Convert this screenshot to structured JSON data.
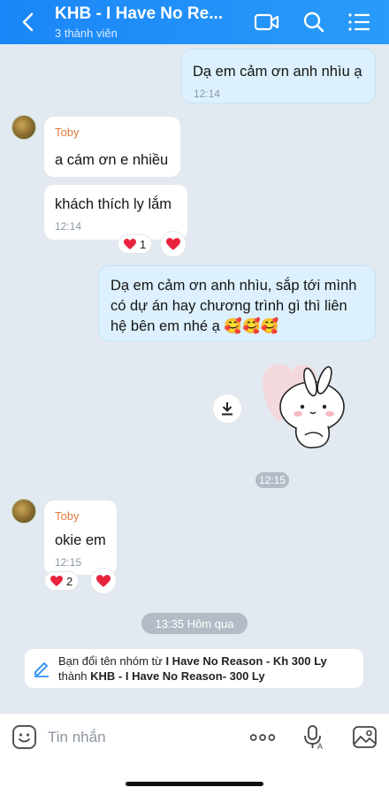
{
  "header": {
    "title": "KHB - I Have No Re...",
    "subtitle": "3 thành viên"
  },
  "messages": [
    {
      "text": "Dạ em cảm ơn anh nhìu ạ",
      "time": "12:14"
    },
    {
      "sender": "Toby",
      "text": "a cám ơn e nhiều"
    },
    {
      "text": "khách thích ly lắm",
      "time": "12:14",
      "reaction_count": "1"
    },
    {
      "text_line1": "Dạ em cảm ơn anh nhìu, sắp tới mình",
      "text_line2": "có dự án hay chương trình gì thì liên",
      "text_line3": "hệ bên em nhé ạ 🥰🥰🥰"
    },
    {
      "sticker_time": "12:15"
    },
    {
      "sender": "Toby",
      "text": "okie em",
      "time": "12:15",
      "reaction_count": "2"
    }
  ],
  "date_divider": "13:35 Hôm qua",
  "notice": {
    "prefix": "Bạn đổi tên nhóm từ ",
    "old_name": "I Have No Reason - Kh 300 Ly",
    "middle": "thành ",
    "new_name": "KHB - I Have No Reason- 300 Ly"
  },
  "input": {
    "placeholder": "Tin nhắn"
  },
  "colors": {
    "header": "#1a86f7",
    "me_bubble": "#dcf1fd",
    "sender_name": "#e07b3c",
    "heart": "#e8243c"
  },
  "icons": [
    "back-icon",
    "video-call-icon",
    "search-icon",
    "menu-icon",
    "download-icon",
    "heart-icon",
    "emoji-icon",
    "more-icon",
    "voice-icon",
    "image-icon",
    "edit-icon"
  ]
}
